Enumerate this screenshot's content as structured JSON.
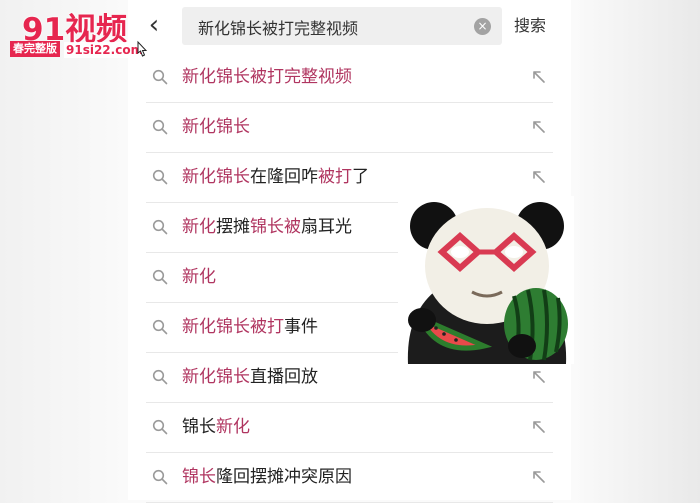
{
  "watermark": {
    "brand": "91视频",
    "tagline": "春完整版",
    "url": "91si22.com"
  },
  "header": {
    "search_value": "新化锦长被打完整视频",
    "search_button": "搜索"
  },
  "icons": {
    "back": "chevron-left-icon",
    "clear": "clear-circle-icon",
    "search": "search-icon",
    "fill": "arrow-up-left-icon"
  },
  "colors": {
    "highlight": "#b03560",
    "brand": "#e6264f"
  },
  "suggestions": [
    {
      "segments": [
        {
          "t": "新化锦长被打完整视频",
          "h": true
        }
      ]
    },
    {
      "segments": [
        {
          "t": "新化锦长",
          "h": true
        }
      ]
    },
    {
      "segments": [
        {
          "t": "新化锦长",
          "h": true
        },
        {
          "t": "在隆回咋",
          "h": false
        },
        {
          "t": "被打",
          "h": true
        },
        {
          "t": "了",
          "h": false
        }
      ]
    },
    {
      "segments": [
        {
          "t": "新化",
          "h": true
        },
        {
          "t": "摆摊",
          "h": false
        },
        {
          "t": "锦长被",
          "h": true
        },
        {
          "t": "扇耳光",
          "h": false
        }
      ]
    },
    {
      "segments": [
        {
          "t": "新化",
          "h": true
        }
      ]
    },
    {
      "segments": [
        {
          "t": "新化锦长被打",
          "h": true
        },
        {
          "t": "事件",
          "h": false
        }
      ]
    },
    {
      "segments": [
        {
          "t": "新化锦长",
          "h": true
        },
        {
          "t": "直播回放",
          "h": false
        }
      ]
    },
    {
      "segments": [
        {
          "t": "锦长",
          "h": false
        },
        {
          "t": "新化",
          "h": true
        }
      ]
    },
    {
      "segments": [
        {
          "t": "锦长",
          "h": true
        },
        {
          "t": "隆回摆摊冲突原因",
          "h": false
        }
      ]
    }
  ]
}
